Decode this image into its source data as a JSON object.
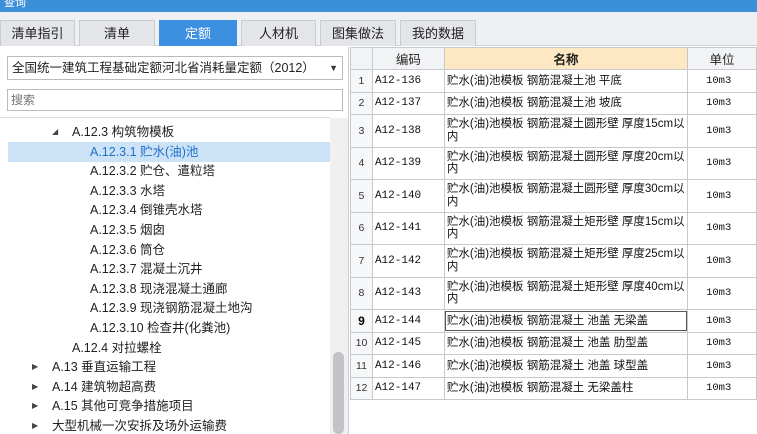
{
  "window": {
    "title": "查询"
  },
  "tabs": [
    {
      "label": "清单指引",
      "active": false
    },
    {
      "label": "清单",
      "active": false
    },
    {
      "label": "定额",
      "active": true
    },
    {
      "label": "人材机",
      "active": false
    },
    {
      "label": "图集做法",
      "active": false
    },
    {
      "label": "我的数据",
      "active": false
    }
  ],
  "quota_library": {
    "selected": "全国统一建筑工程基础定额河北省消耗量定额（2012）"
  },
  "search": {
    "placeholder": "搜索",
    "value": ""
  },
  "tree": [
    {
      "label": "A.12.3 构筑物模板",
      "level": 2,
      "expander": "expanded",
      "selected": false
    },
    {
      "label": "A.12.3.1 贮水(油)池",
      "level": 3,
      "expander": "none",
      "selected": true
    },
    {
      "label": "A.12.3.2 贮仓、遣粒塔",
      "level": 3,
      "expander": "none",
      "selected": false
    },
    {
      "label": "A.12.3.3 水塔",
      "level": 3,
      "expander": "none",
      "selected": false
    },
    {
      "label": "A.12.3.4 倒锥壳水塔",
      "level": 3,
      "expander": "none",
      "selected": false
    },
    {
      "label": "A.12.3.5 烟囱",
      "level": 3,
      "expander": "none",
      "selected": false
    },
    {
      "label": "A.12.3.6 筒仓",
      "level": 3,
      "expander": "none",
      "selected": false
    },
    {
      "label": "A.12.3.7 混凝土沉井",
      "level": 3,
      "expander": "none",
      "selected": false
    },
    {
      "label": "A.12.3.8 现浇混凝土通廊",
      "level": 3,
      "expander": "none",
      "selected": false
    },
    {
      "label": "A.12.3.9 现浇钢筋混凝土地沟",
      "level": 3,
      "expander": "none",
      "selected": false
    },
    {
      "label": "A.12.3.10 检查井(化粪池)",
      "level": 3,
      "expander": "none",
      "selected": false
    },
    {
      "label": "A.12.4 对拉螺栓",
      "level": 2,
      "expander": "none",
      "selected": false
    },
    {
      "label": "A.13 垂直运输工程",
      "level": 1,
      "expander": "collapsed",
      "selected": false
    },
    {
      "label": "A.14 建筑物超高费",
      "level": 1,
      "expander": "collapsed",
      "selected": false
    },
    {
      "label": "A.15 其他可竞争措施项目",
      "level": 1,
      "expander": "collapsed",
      "selected": false
    },
    {
      "label": "大型机械一次安拆及场外运输费",
      "level": 1,
      "expander": "collapsed",
      "selected": false
    }
  ],
  "table": {
    "headers": {
      "index": "",
      "code": "编码",
      "name": "名称",
      "unit": "单位"
    },
    "current_row": 9,
    "rows": [
      {
        "index": "1",
        "code": "A12-136",
        "name": "贮水(油)池模板 钢筋混凝土池 平底",
        "unit": "10m3"
      },
      {
        "index": "2",
        "code": "A12-137",
        "name": "贮水(油)池模板 钢筋混凝土池 坡底",
        "unit": "10m3"
      },
      {
        "index": "3",
        "code": "A12-138",
        "name": "贮水(油)池模板 钢筋混凝土圆形壁 厚度15cm以内",
        "unit": "10m3"
      },
      {
        "index": "4",
        "code": "A12-139",
        "name": "贮水(油)池模板 钢筋混凝土圆形壁 厚度20cm以内",
        "unit": "10m3"
      },
      {
        "index": "5",
        "code": "A12-140",
        "name": "贮水(油)池模板 钢筋混凝土圆形壁 厚度30cm以内",
        "unit": "10m3"
      },
      {
        "index": "6",
        "code": "A12-141",
        "name": "贮水(油)池模板 钢筋混凝土矩形壁 厚度15cm以内",
        "unit": "10m3"
      },
      {
        "index": "7",
        "code": "A12-142",
        "name": "贮水(油)池模板 钢筋混凝土矩形壁 厚度25cm以内",
        "unit": "10m3"
      },
      {
        "index": "8",
        "code": "A12-143",
        "name": "贮水(油)池模板 钢筋混凝土矩形壁 厚度40cm以内",
        "unit": "10m3"
      },
      {
        "index": "9",
        "code": "A12-144",
        "name": "贮水(油)池模板 钢筋混凝土 池盖 无梁盖",
        "unit": "10m3"
      },
      {
        "index": "10",
        "code": "A12-145",
        "name": "贮水(油)池模板 钢筋混凝土 池盖 肋型盖",
        "unit": "10m3"
      },
      {
        "index": "11",
        "code": "A12-146",
        "name": "贮水(油)池模板 钢筋混凝土 池盖 球型盖",
        "unit": "10m3"
      },
      {
        "index": "12",
        "code": "A12-147",
        "name": "贮水(油)池模板 钢筋混凝土 无梁盖柱",
        "unit": "10m3"
      }
    ]
  },
  "colors": {
    "accent": "#3d8fe0",
    "selection": "#cce3f7",
    "header_highlight": "#fde8c3"
  },
  "icons": {
    "dropdown": "chevron-down-icon",
    "tree_expanded": "triangle-down-icon",
    "tree_collapsed": "triangle-right-icon"
  }
}
